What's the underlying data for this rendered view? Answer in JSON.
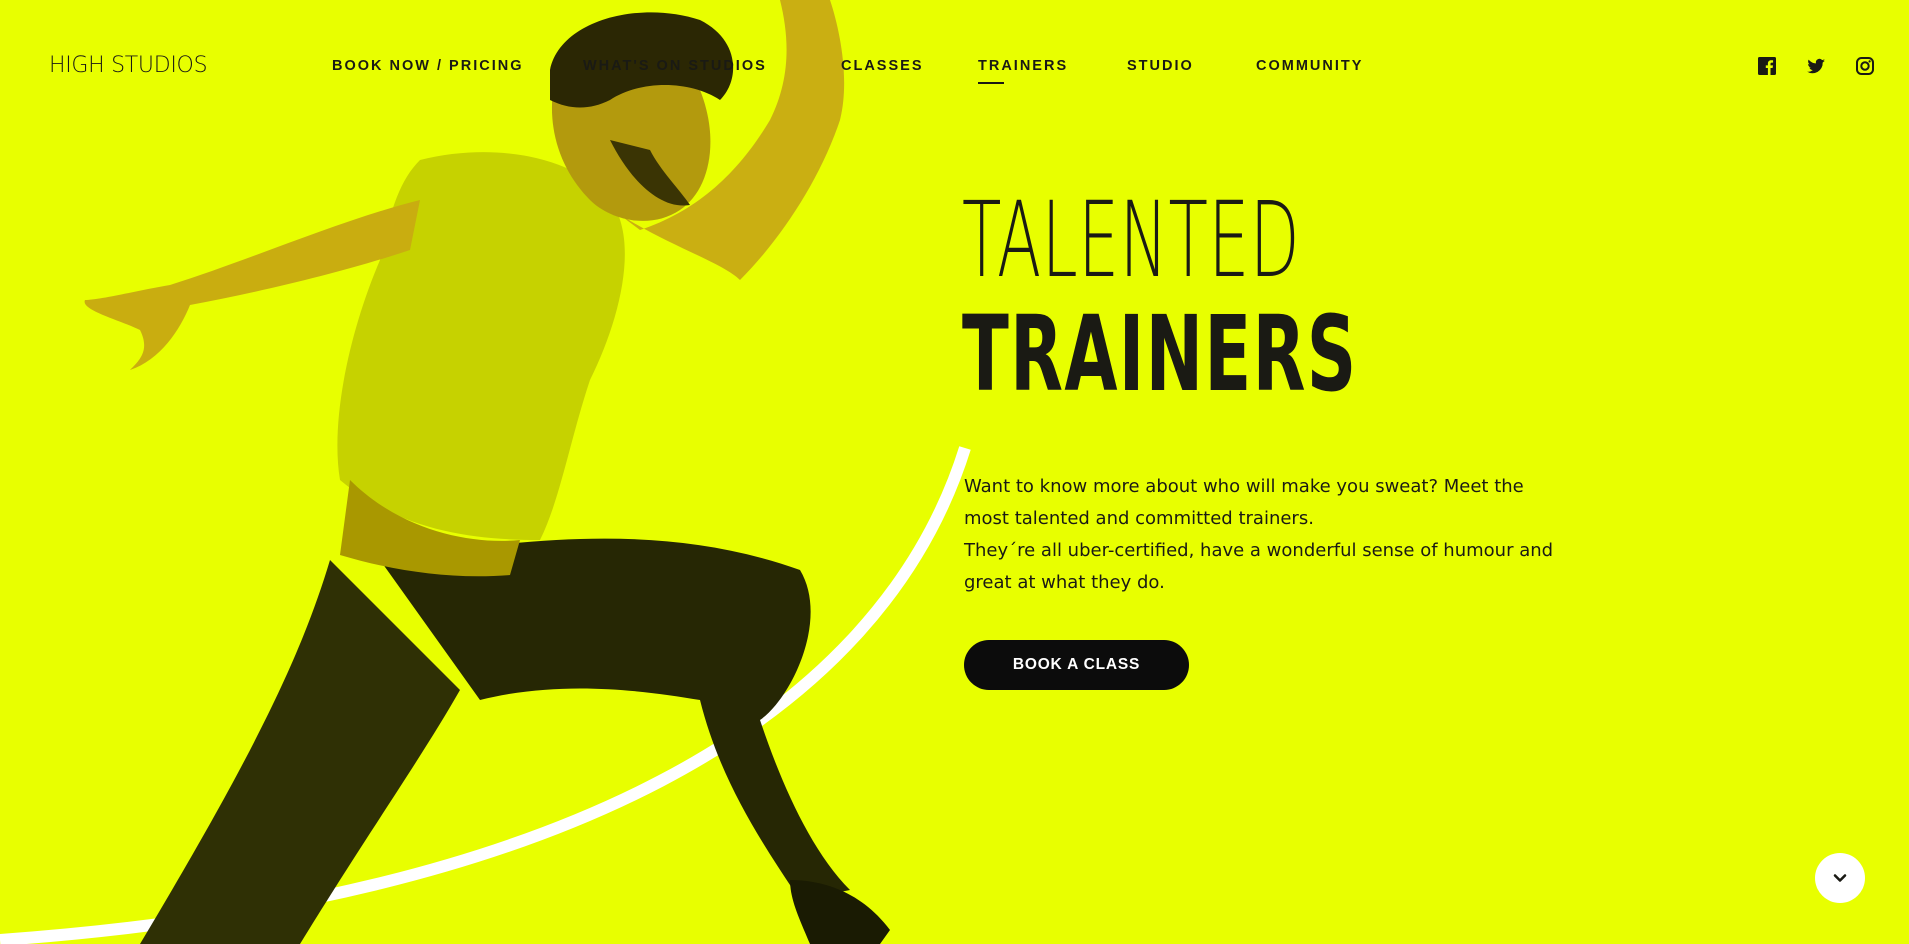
{
  "brand": {
    "logo_text": "HIGH STUDIOS"
  },
  "nav": {
    "items": [
      {
        "label": "BOOK NOW / PRICING",
        "active": false
      },
      {
        "label": "WHAT'S ON STUDIOS",
        "active": false
      },
      {
        "label": "CLASSES",
        "active": false
      },
      {
        "label": "TRAINERS",
        "active": true
      },
      {
        "label": "STUDIO",
        "active": false
      },
      {
        "label": "COMMUNITY",
        "active": false
      }
    ]
  },
  "social": {
    "icons": [
      "facebook-icon",
      "twitter-icon",
      "instagram-icon"
    ]
  },
  "hero": {
    "title_line1": "TALENTED",
    "title_line2": "TRAINERS",
    "paragraph1": "Want to know more about who will make you sweat? Meet the most talented and committed trainers.",
    "paragraph2": "They´re all uber-certified, have a wonderful sense of humour and great at what they do.",
    "cta_label": "BOOK A CLASS"
  },
  "scroll": {
    "icon": "chevron-down-icon"
  },
  "colors": {
    "background": "#e8ff00",
    "text": "#1a1a14",
    "button": "#0c0c0c",
    "arc": "#ffffff"
  }
}
